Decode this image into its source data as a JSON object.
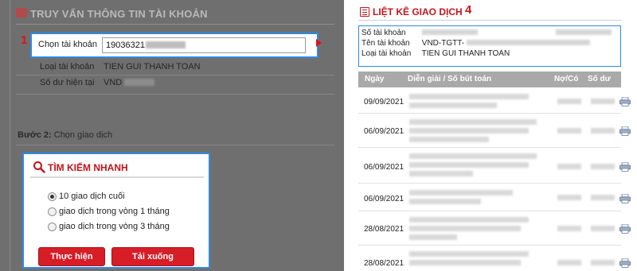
{
  "annotations": {
    "n1": "1",
    "n2": "2",
    "n3": "3",
    "n4": "4"
  },
  "account_panel": {
    "title": "TRUY VẤN THÔNG TIN TÀI KHOẢN",
    "select_label": "Chọn tài khoản",
    "account_number": "19036321",
    "type_label": "Loại tài khoản",
    "type_value": "TIEN GUI THANH TOAN",
    "balance_label": "Số dư hiện tại",
    "balance_value": "VND"
  },
  "step2": {
    "prefix": "Bước 2:",
    "text": " Chọn giao dịch"
  },
  "quick_search": {
    "title": "TÌM KIẾM NHANH",
    "options": [
      {
        "label": "10 giao dịch cuối",
        "selected": true
      },
      {
        "label": "giao dịch trong vòng 1 tháng",
        "selected": false
      },
      {
        "label": "giao dịch trong vòng 3 tháng",
        "selected": false
      }
    ],
    "execute_label": "Thực hiện",
    "download_label": "Tải xuống"
  },
  "transactions": {
    "title": "LIỆT KÊ GIAO DỊCH",
    "info": {
      "account_label": "Số tài khoản",
      "name_label": "Tên tài khoản",
      "name_value": "VND-TGTT-",
      "type_label": "Loại tài khoản",
      "type_value": "TIEN GUI THANH TOAN"
    },
    "columns": [
      "Ngày",
      "Diễn giải / Số bút toán",
      "Nợ/Có",
      "Số dư"
    ],
    "rows": [
      {
        "date": "09/09/2021"
      },
      {
        "date": "06/09/2021"
      },
      {
        "date": "06/09/2021"
      },
      {
        "date": "06/09/2021"
      },
      {
        "date": "28/08/2021"
      },
      {
        "date": "28/08/2021"
      }
    ]
  },
  "colors": {
    "accent_red": "#d71d26",
    "highlight_blue": "#2d8ae6",
    "overlay_gray": "#6f6f6f"
  }
}
